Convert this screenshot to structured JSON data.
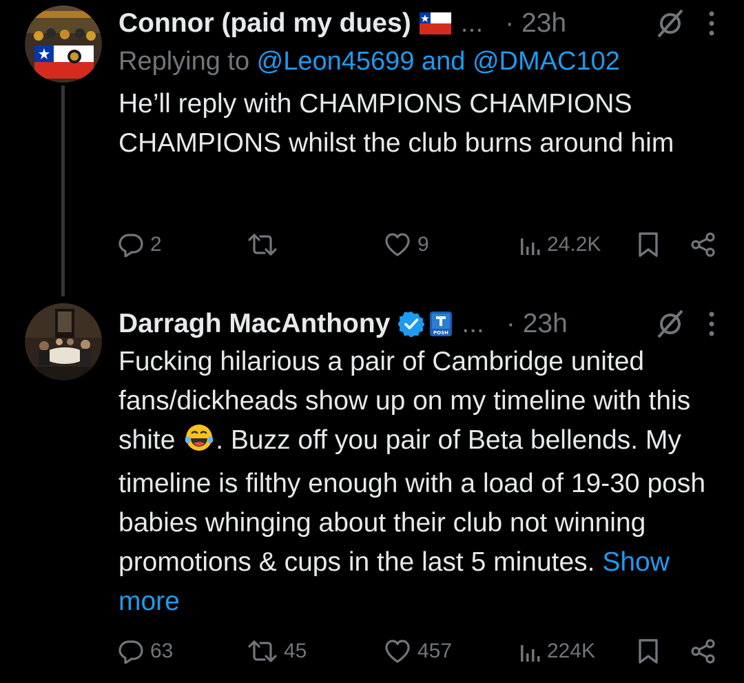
{
  "tweets": [
    {
      "author": "Connor (paid my dues)",
      "ellipsis": "...",
      "time": "· 23h",
      "reply_prefix": "Replying to ",
      "reply_handle_1": "@Leon45699",
      "reply_and": " and ",
      "reply_handle_2": "@DMAC102",
      "text": "He’ll reply with CHAMPIONS CHAMPIONS CHAMPIONS whilst the club burns around him",
      "replies": "2",
      "retweets": "",
      "likes": "9",
      "views": "24.2K",
      "icons": [
        "chile-flag-icon",
        "grok-icon",
        "more-vertical-icon",
        "reply-icon",
        "retweet-icon",
        "like-icon",
        "views-icon",
        "bookmark-icon",
        "share-icon"
      ]
    },
    {
      "author": "Darragh MacAnthony",
      "ellipsis": "...",
      "time": "· 23h",
      "text_part1": "Fucking hilarious a pair of Cambridge united fans/dickheads show up on my timeline with this shite ",
      "text_emoji": "😂",
      "text_part2": ".  Buzz off you pair of Beta bellends. My timeline is filthy enough with a load of 19-30 posh babies whinging about their club not winning promotions & cups in the last 5 minutes. ",
      "show_more": "Show more",
      "replies": "63",
      "retweets": "45",
      "likes": "457",
      "views": "224K",
      "badge_text": "POSH",
      "icons": [
        "verified-icon",
        "club-badge-icon",
        "grok-icon",
        "more-vertical-icon",
        "reply-icon",
        "retweet-icon",
        "like-icon",
        "views-icon",
        "bookmark-icon",
        "share-icon"
      ]
    }
  ],
  "colors": {
    "background": "#000000",
    "text": "#e7e9ea",
    "secondary": "#71767b",
    "link": "#1d9bf0",
    "verified": "#1d9bf0",
    "thread_line": "#333639"
  }
}
